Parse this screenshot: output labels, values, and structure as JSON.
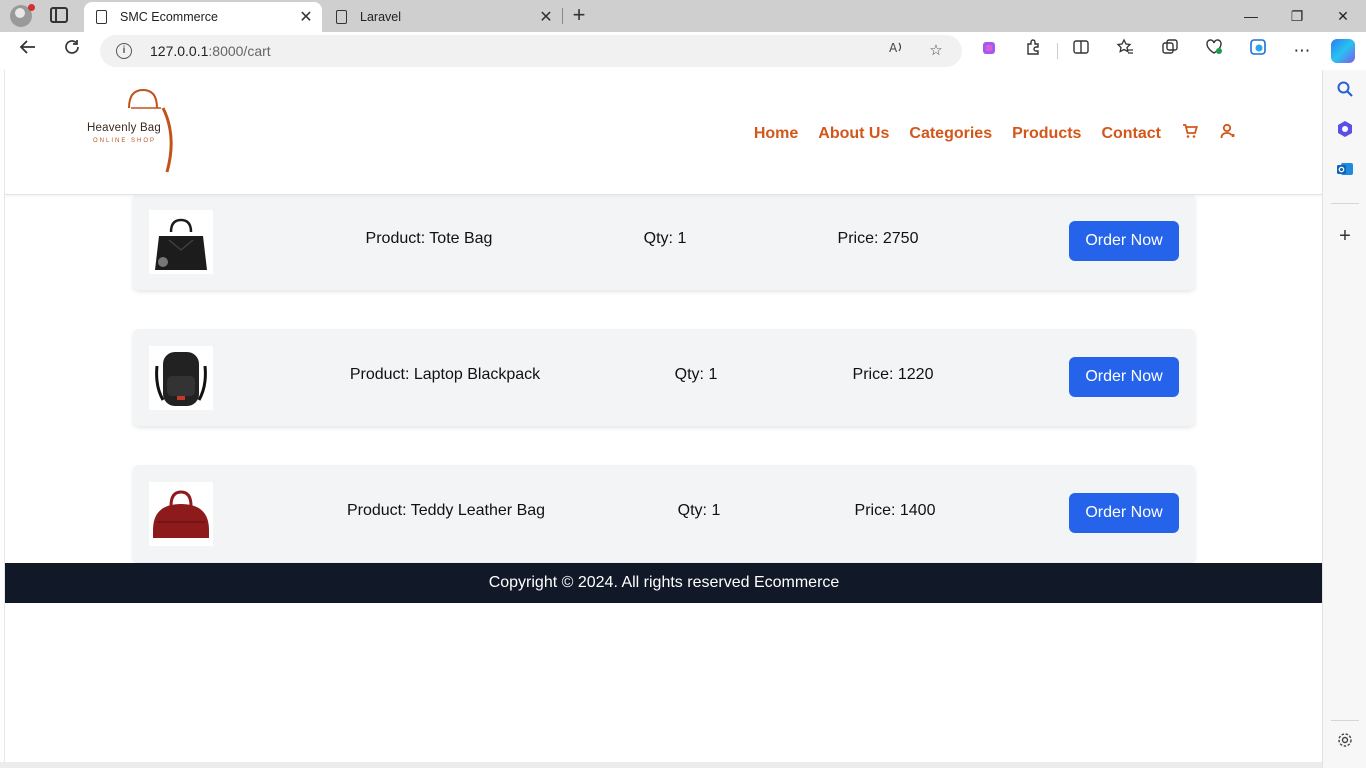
{
  "browser": {
    "tabs": [
      {
        "title": "SMC Ecommerce",
        "active": true
      },
      {
        "title": "Laravel",
        "active": false
      }
    ],
    "close_glyph": "✕",
    "new_tab_glyph": "+",
    "address": {
      "host": "127.0.0.1",
      "path": ":8000/cart"
    },
    "window_buttons": {
      "minimize": "—",
      "restore": "❐",
      "close": "✕"
    }
  },
  "site": {
    "logo": {
      "brand": "Heavenly Bag",
      "tagline": "ONLINE SHOP"
    },
    "nav": [
      "Home",
      "About Us",
      "Categories",
      "Products",
      "Contact"
    ],
    "nav_icons": [
      "cart-icon",
      "user-icon"
    ]
  },
  "cart": {
    "items": [
      {
        "product": "Product: Tote Bag",
        "qty": "Qty: 1",
        "price": "Price: 2750",
        "button": "Order Now",
        "image": "black-tote-bag",
        "color": "#1c1c1c"
      },
      {
        "product": "Product: Laptop Blackpack",
        "qty": "Qty: 1",
        "price": "Price: 1220",
        "button": "Order Now",
        "image": "black-backpack",
        "color": "#222222"
      },
      {
        "product": "Product: Teddy Leather Bag",
        "qty": "Qty: 1",
        "price": "Price: 1400",
        "button": "Order Now",
        "image": "red-leather-bag",
        "color": "#8e1b1b"
      }
    ]
  },
  "footer": {
    "text": "Copyright © 2024. All rights reserved Ecommerce"
  },
  "colors": {
    "accent": "#d3571a",
    "button": "#2563eb",
    "footer_bg": "#111827",
    "card_bg": "#f3f4f6"
  }
}
